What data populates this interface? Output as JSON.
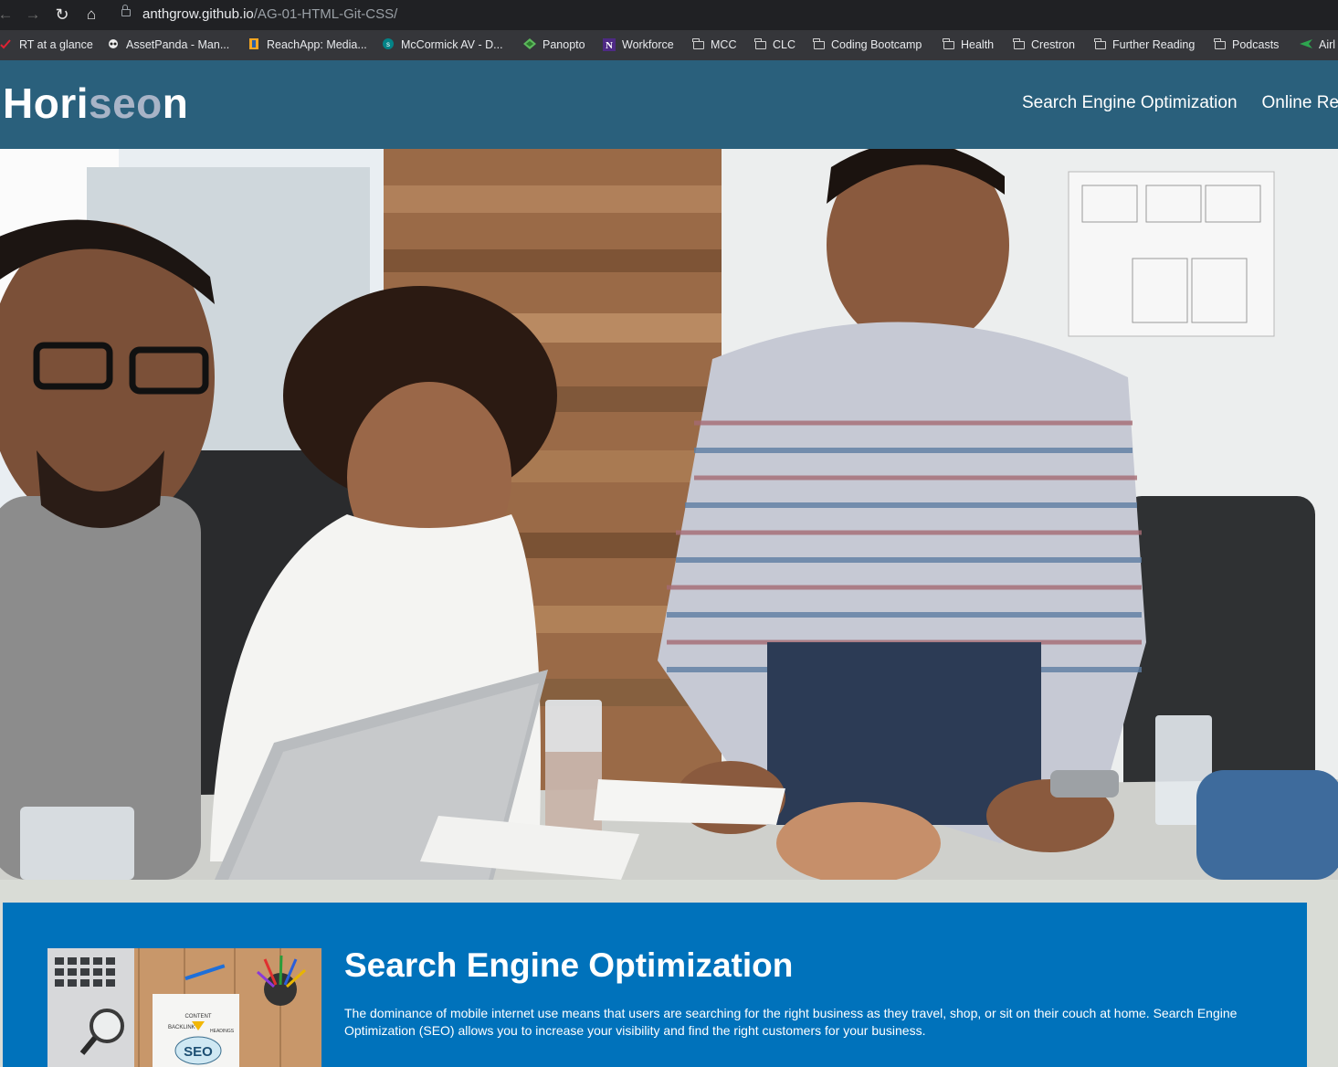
{
  "browser": {
    "url_host": "anthgrow.github.io",
    "url_path": "/AG-01-HTML-Git-CSS/",
    "bookmarks": [
      {
        "label": "RT at a glance",
        "icon": "check-icon"
      },
      {
        "label": "AssetPanda - Man...",
        "icon": "panda-icon"
      },
      {
        "label": "ReachApp: Media...",
        "icon": "reachapp-icon"
      },
      {
        "label": "McCormick AV - D...",
        "icon": "sharepoint-icon"
      },
      {
        "label": "Panopto",
        "icon": "panopto-icon"
      },
      {
        "label": "Workforce",
        "icon": "northwestern-icon"
      },
      {
        "label": "MCC",
        "icon": "folder-icon"
      },
      {
        "label": "CLC",
        "icon": "folder-icon"
      },
      {
        "label": "Coding Bootcamp",
        "icon": "folder-icon"
      },
      {
        "label": "Health",
        "icon": "folder-icon"
      },
      {
        "label": "Crestron",
        "icon": "folder-icon"
      },
      {
        "label": "Further Reading",
        "icon": "folder-icon"
      },
      {
        "label": "Podcasts",
        "icon": "folder-icon"
      },
      {
        "label": "Airl",
        "icon": "airline-icon"
      }
    ]
  },
  "header": {
    "logo_start": "Hori",
    "logo_mid": "seo",
    "logo_end": "n",
    "nav": [
      "Search Engine Optimization",
      "Online Rep"
    ]
  },
  "content": {
    "title": "Search Engine Optimization",
    "text": "The dominance of mobile internet use means that users are searching for the right business as they travel, shop, or sit on their couch at home. Search Engine Optimization (SEO) allows you to increase your visibility and find the right customers for your business."
  },
  "colors": {
    "header_bg": "#2a607c",
    "logo_accent": "#a8b4c7",
    "card_bg": "#0072bb",
    "page_bg": "#d9dcd6"
  }
}
